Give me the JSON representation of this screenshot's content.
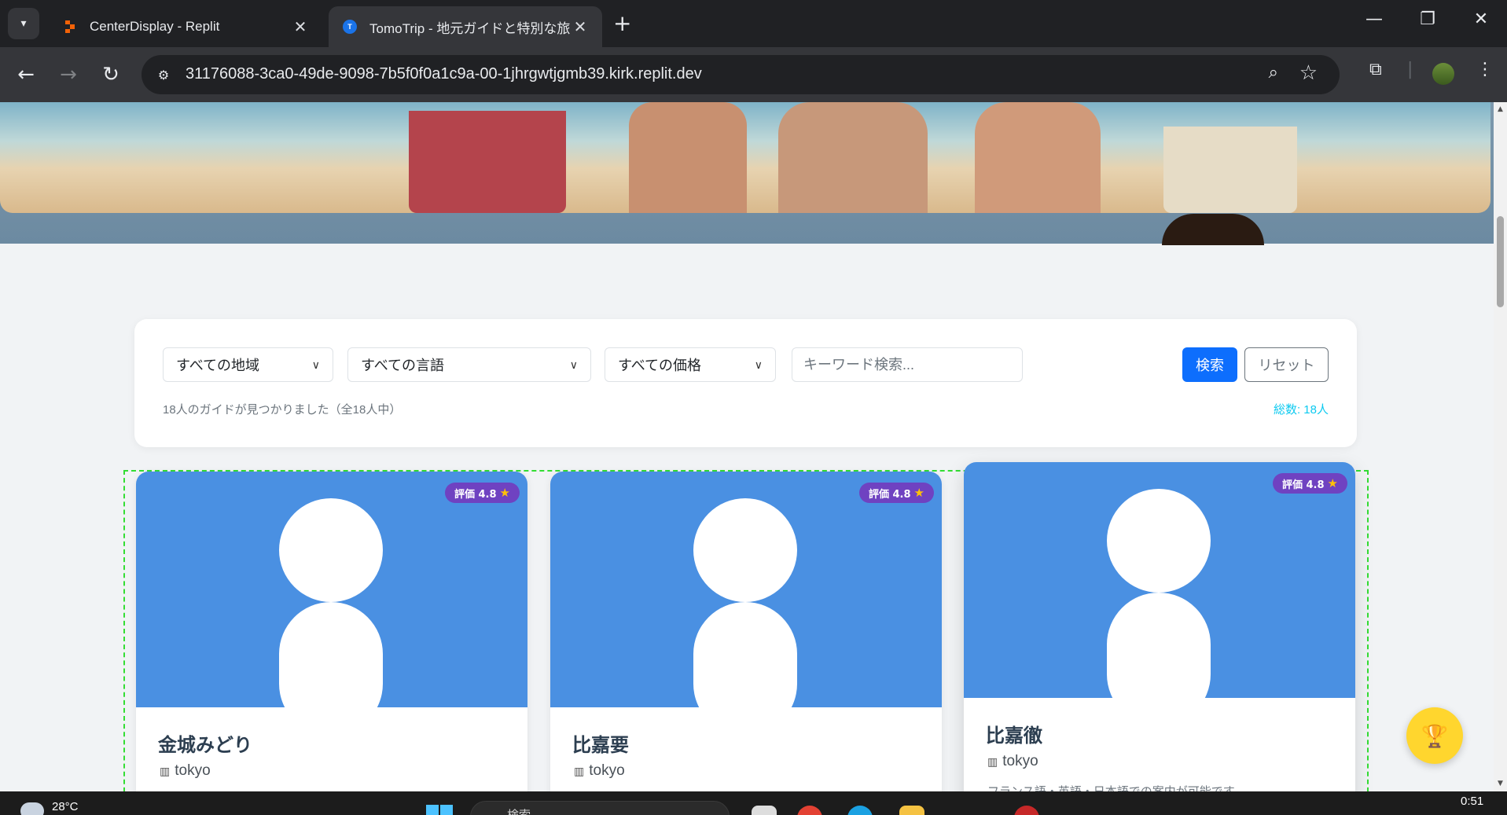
{
  "browser": {
    "tabs": [
      {
        "title": "CenterDisplay - Replit",
        "active": false
      },
      {
        "title": "TomoTrip - 地元ガイドと特別な旅",
        "active": true
      }
    ],
    "url": "31176088-3ca0-49de-9098-7b5f0f0a1c9a-00-1jhrgwtjgmb39.kirk.replit.dev"
  },
  "filters": {
    "region": "すべての地域",
    "language": "すべての言語",
    "price": "すべての価格",
    "keyword_placeholder": "キーワード検索...",
    "search_label": "検索",
    "reset_label": "リセット",
    "result_text": "18人のガイドが見つかりました（全18人中）",
    "total_text": "総数: 18人"
  },
  "guides": [
    {
      "name": "金城みどり",
      "location": "tokyo",
      "rating": "評価 4.8",
      "description": ""
    },
    {
      "name": "比嘉要",
      "location": "tokyo",
      "rating": "評価 4.8",
      "description": ""
    },
    {
      "name": "比嘉徹",
      "location": "tokyo",
      "rating": "評価 4.8",
      "description": "フランス語・英語・日本語での案内が可能です"
    }
  ],
  "taskbar": {
    "temperature": "28°C",
    "search_placeholder": "検索",
    "time": "0:51"
  },
  "colors": {
    "accent": "#0d6efd",
    "photo_bg": "#4a90e2",
    "badge": "#6f42c1",
    "total": "#0dcaf0",
    "fab": "#ffd62e"
  }
}
